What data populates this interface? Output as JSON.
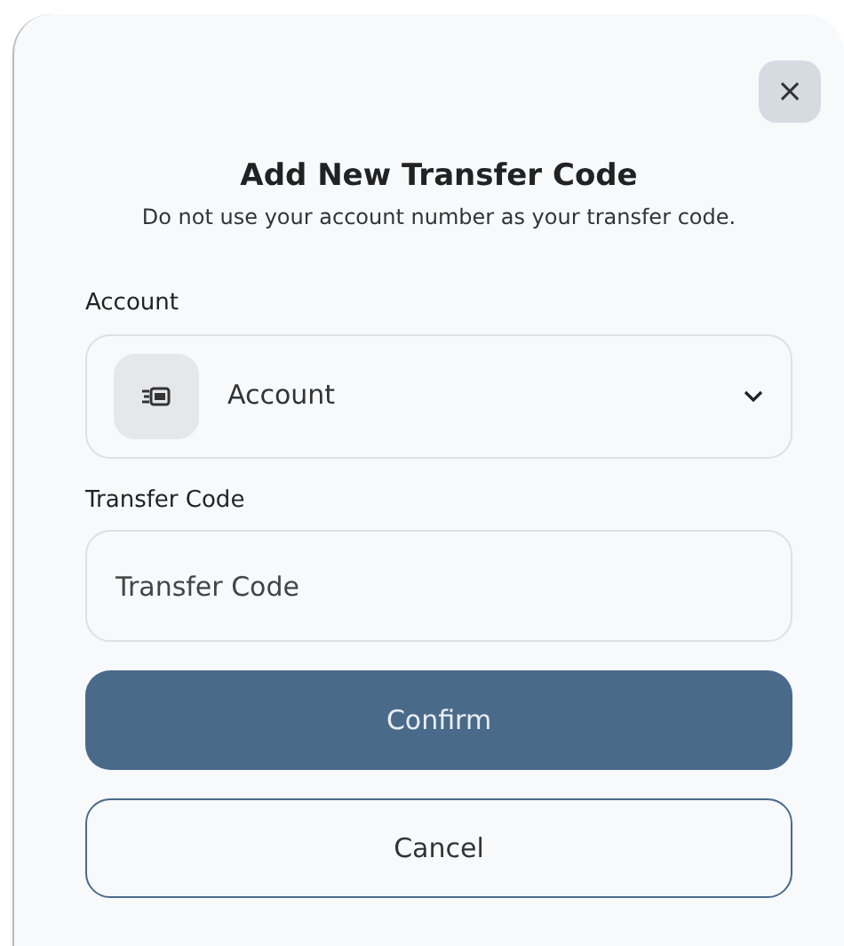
{
  "dialog": {
    "close_label": "×",
    "title": "Add New Transfer Code",
    "subtitle": "Do not use your account number as your transfer code.",
    "account": {
      "label": "Account",
      "value": "Account"
    },
    "transfer_code": {
      "label": "Transfer Code",
      "placeholder": "Transfer Code"
    },
    "buttons": [
      {
        "kind": "primary",
        "label": "Confirm"
      },
      {
        "kind": "outline",
        "label": "Cancel"
      }
    ]
  }
}
